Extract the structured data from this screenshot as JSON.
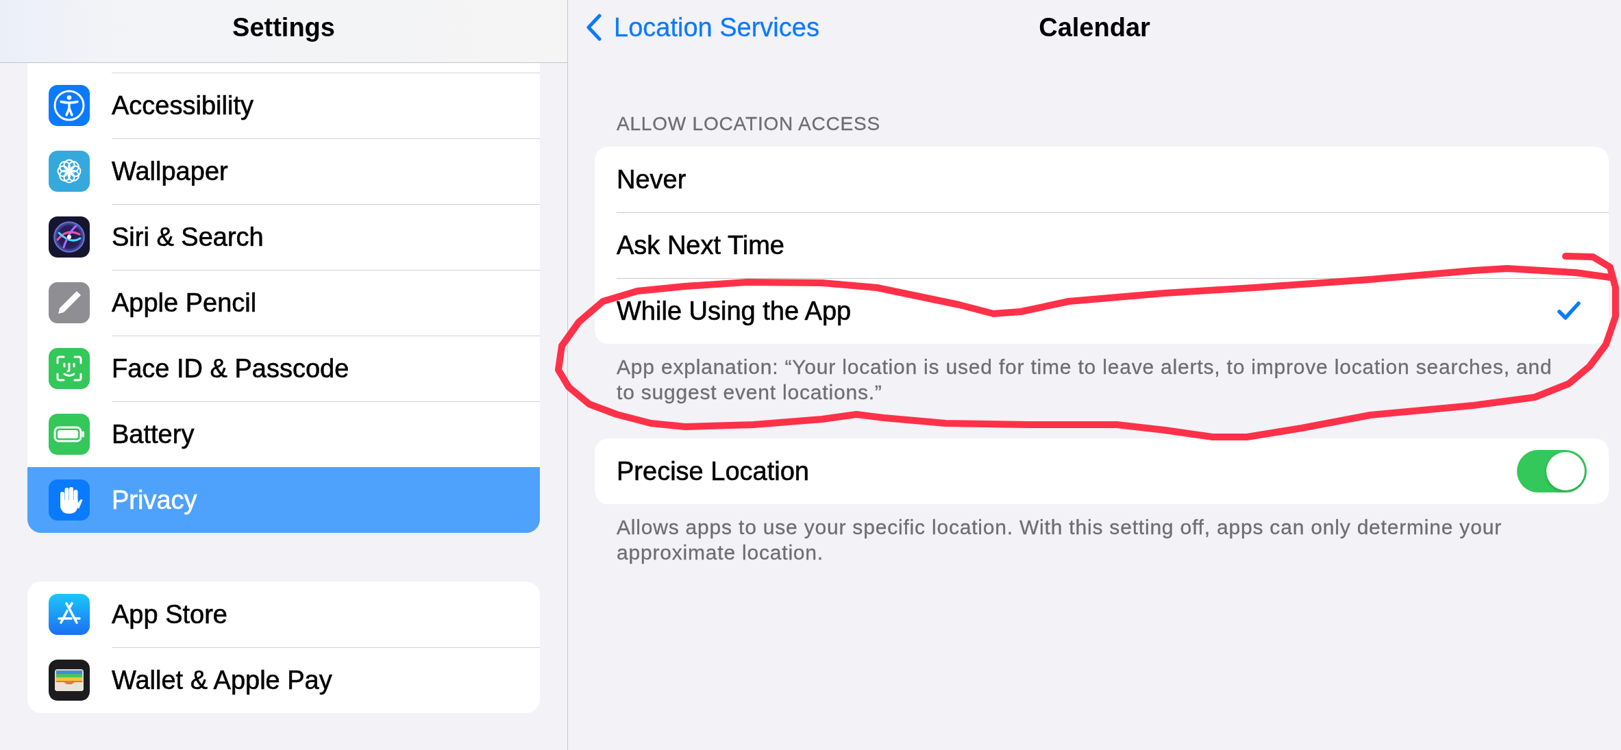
{
  "sidebar": {
    "title": "Settings",
    "groups": [
      {
        "items": [
          {
            "label": "Accessibility",
            "selected": false
          },
          {
            "label": "Wallpaper",
            "selected": false
          },
          {
            "label": "Siri & Search",
            "selected": false
          },
          {
            "label": "Apple Pencil",
            "selected": false
          },
          {
            "label": "Face ID & Passcode",
            "selected": false
          },
          {
            "label": "Battery",
            "selected": false
          },
          {
            "label": "Privacy",
            "selected": true
          }
        ]
      },
      {
        "items": [
          {
            "label": "App Store",
            "selected": false
          },
          {
            "label": "Wallet & Apple Pay",
            "selected": false
          }
        ]
      }
    ]
  },
  "detail": {
    "back": "Location Services",
    "title": "Calendar",
    "sections": [
      {
        "header": "ALLOW LOCATION ACCESS",
        "rows": [
          {
            "kind": "option",
            "label": "Never",
            "selected": false
          },
          {
            "kind": "option",
            "label": "Ask Next Time",
            "selected": false
          },
          {
            "kind": "option",
            "label": "While Using the App",
            "selected": true
          }
        ],
        "footer": "App explanation: “Your location is used for time to leave alerts, to improve location searches, and to suggest event locations.”"
      },
      {
        "rows": [
          {
            "kind": "toggle",
            "label": "Precise Location",
            "on": true
          }
        ],
        "footer": "Allows apps to use your specific location. With this setting off, apps can only determine your approximate location."
      }
    ]
  }
}
